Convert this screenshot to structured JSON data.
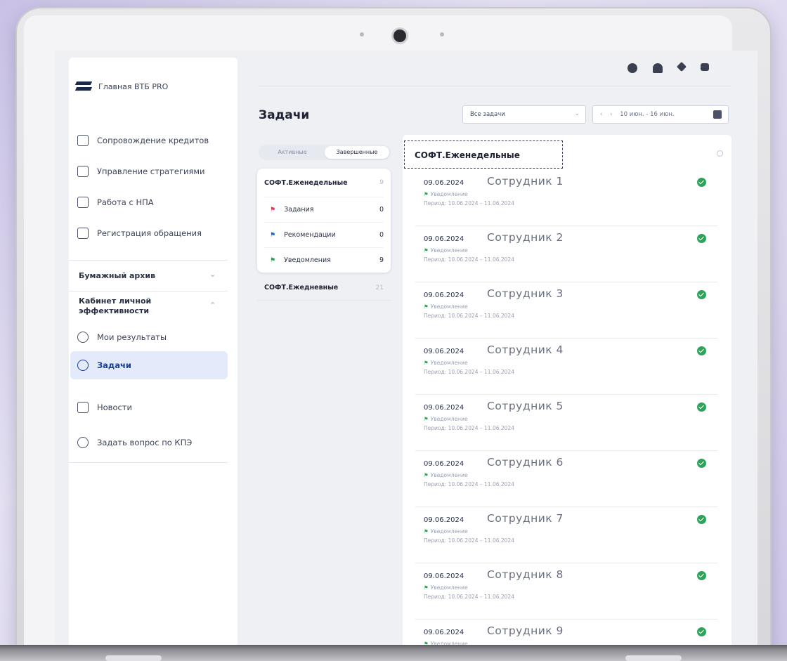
{
  "sidebar": {
    "logo_text": "Главная ВТБ PRO",
    "items": [
      {
        "label": "Сопровождение кредитов"
      },
      {
        "label": "Управление стратегиями"
      },
      {
        "label": "Работа с НПА"
      },
      {
        "label": "Регистрация обращения"
      }
    ],
    "section_archive": "Бумажный архив",
    "section_kpe": "Кабинет личной эффективности",
    "kpe_items": [
      {
        "label": "Мои результаты"
      },
      {
        "label": "Задачи"
      },
      {
        "label": "Новости"
      },
      {
        "label": "Задать вопрос по КПЭ"
      }
    ]
  },
  "header": {
    "page_title": "Задачи",
    "filter_select": "Все задачи",
    "date_range": "10 июн. - 16 июн."
  },
  "tabs": {
    "active": "Активные",
    "completed": "Завершенные"
  },
  "groups": {
    "weekly": {
      "title": "СОФТ.Еженедельные",
      "count": "9",
      "sub": [
        {
          "label": "Задания",
          "count": "0",
          "color": "#d23c55"
        },
        {
          "label": "Рекомендации",
          "count": "0",
          "color": "#2a63c9"
        },
        {
          "label": "Уведомления",
          "count": "9",
          "color": "#2f9f57"
        }
      ]
    },
    "daily": {
      "title": "СОФТ.Ежедневные",
      "count": "21"
    }
  },
  "list": {
    "title": "СОФТ.Еженедельные",
    "type_label": "Уведомление",
    "period_label": "Период: 10.06.2024 – 11.06.2024",
    "tasks": [
      {
        "date": "09.06.2024",
        "employee": "Сотрудник 1"
      },
      {
        "date": "09.06.2024",
        "employee": "Сотрудник 2"
      },
      {
        "date": "09.06.2024",
        "employee": "Сотрудник 3"
      },
      {
        "date": "09.06.2024",
        "employee": "Сотрудник 4"
      },
      {
        "date": "09.06.2024",
        "employee": "Сотрудник 5"
      },
      {
        "date": "09.06.2024",
        "employee": "Сотрудник 6"
      },
      {
        "date": "09.06.2024",
        "employee": "Сотрудник 7"
      },
      {
        "date": "09.06.2024",
        "employee": "Сотрудник 8"
      },
      {
        "date": "09.06.2024",
        "employee": "Сотрудник 9"
      }
    ]
  },
  "colors": {
    "accent": "#1d3f8f",
    "success": "#2fa35a",
    "active_bg": "#e3ebfb"
  }
}
